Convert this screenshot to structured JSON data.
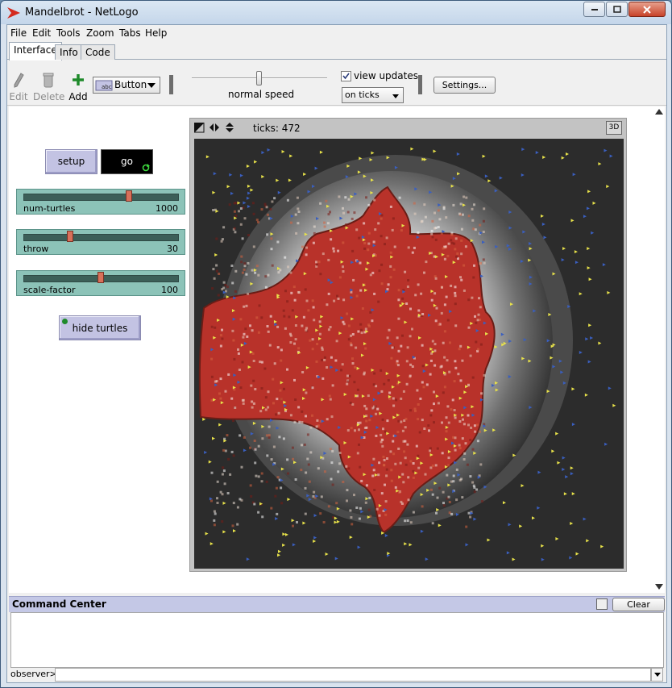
{
  "window": {
    "title": "Mandelbrot - NetLogo"
  },
  "menubar": {
    "items": [
      "File",
      "Edit",
      "Tools",
      "Zoom",
      "Tabs",
      "Help"
    ]
  },
  "tabs": [
    {
      "label": "Interface",
      "active": true
    },
    {
      "label": "Info",
      "active": false
    },
    {
      "label": "Code",
      "active": false
    }
  ],
  "toolbar": {
    "edit_label": "Edit",
    "delete_label": "Delete",
    "add_label": "Add",
    "widget_type": "Button",
    "speed_label": "normal speed",
    "view_updates_label": "view updates",
    "view_updates_checked": true,
    "update_mode": "on ticks",
    "settings_label": "Settings..."
  },
  "widgets": {
    "setup_label": "setup",
    "go_label": "go",
    "sliders": [
      {
        "name": "num-turtles",
        "value": "1000",
        "position": 0.66
      },
      {
        "name": "throw",
        "value": "30",
        "position": 0.3
      },
      {
        "name": "scale-factor",
        "value": "100",
        "position": 0.5
      }
    ],
    "hide_turtles_label": "hide turtles"
  },
  "view": {
    "ticks_label": "ticks: 472",
    "btn_3d": "3D"
  },
  "command_center": {
    "title": "Command Center",
    "clear_label": "Clear",
    "agent": "observer>",
    "input_value": ""
  },
  "colors": {
    "button": "#c3c3e3",
    "slider": "#8cc3b8",
    "fractal_red": "#b8322a",
    "turtle_yellow": "#e8e24a",
    "turtle_blue": "#3a5fbf"
  }
}
